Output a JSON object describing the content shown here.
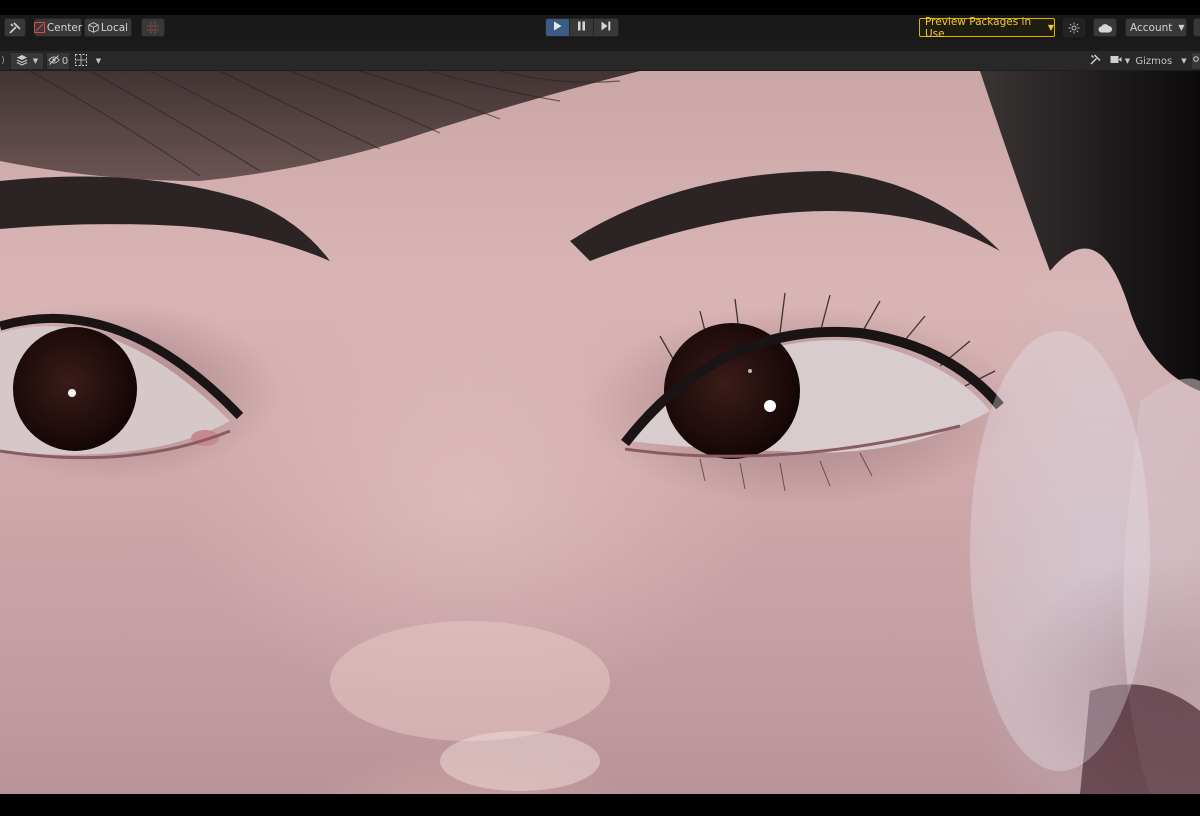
{
  "toolbar": {
    "tools_icon": "tools-icon",
    "pivot_label": "Center",
    "pivot_icon": "pivot-center-icon",
    "space_label": "Local",
    "space_icon": "cube-icon",
    "grid_icon": "grid-snap-icon",
    "play_icon": "play-icon",
    "pause_icon": "pause-icon",
    "step_icon": "step-icon",
    "preview_packages_label": "Preview Packages in Use",
    "services_icon": "services-icon",
    "cloud_icon": "cloud-icon",
    "account_label": "Account",
    "layers_icon": "layers-icon"
  },
  "scene_toolbar": {
    "draw_mode_icon": "shading-mode-icon",
    "visibility_icon": "visibility-hidden-icon",
    "hidden_count": "0",
    "grid_icon": "grid-icon",
    "tools_icon": "tools-icon",
    "camera_icon": "camera-icon",
    "gizmos_label": "Gizmos",
    "search_icon": "search-icon"
  },
  "colors": {
    "play_active": "#3b5a85",
    "preview_accent": "#f3c82f",
    "toolbar_bg": "#191919",
    "scene_toolbar_bg": "#282828"
  },
  "viewport": {
    "content": "rendered close-up of a face with eyes"
  }
}
